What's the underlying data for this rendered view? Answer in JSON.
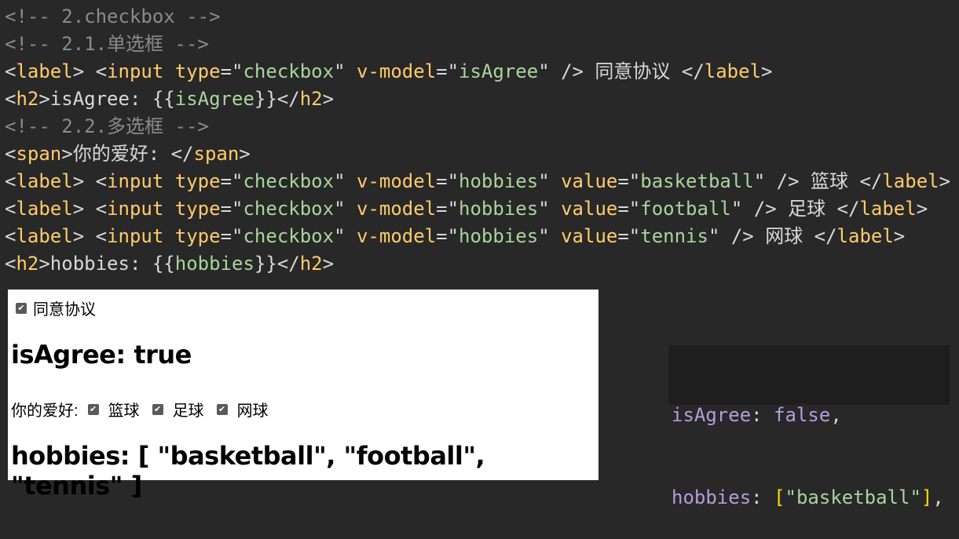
{
  "code_lines": [
    {
      "parts": [
        {
          "cls": "c-comment",
          "text": "<!-- 2.checkbox -->"
        }
      ]
    },
    {
      "parts": [
        {
          "cls": "c-comment",
          "text": "<!-- 2.1.单选框 -->"
        }
      ]
    },
    {
      "parts": [
        {
          "cls": "c-plain",
          "text": "<"
        },
        {
          "cls": "c-tag",
          "text": "label"
        },
        {
          "cls": "c-plain",
          "text": "> <"
        },
        {
          "cls": "c-tag",
          "text": "input"
        },
        {
          "cls": "c-plain",
          "text": " "
        },
        {
          "cls": "c-attr",
          "text": "type"
        },
        {
          "cls": "c-plain",
          "text": "=\""
        },
        {
          "cls": "c-str",
          "text": "checkbox"
        },
        {
          "cls": "c-plain",
          "text": "\" "
        },
        {
          "cls": "c-attr",
          "text": "v-model"
        },
        {
          "cls": "c-plain",
          "text": "=\""
        },
        {
          "cls": "c-str",
          "text": "isAgree"
        },
        {
          "cls": "c-plain",
          "text": "\" /> 同意协议 </"
        },
        {
          "cls": "c-tag",
          "text": "label"
        },
        {
          "cls": "c-plain",
          "text": ">"
        }
      ]
    },
    {
      "parts": [
        {
          "cls": "c-plain",
          "text": "<"
        },
        {
          "cls": "c-tag",
          "text": "h2"
        },
        {
          "cls": "c-plain",
          "text": ">isAgree: {{"
        },
        {
          "cls": "c-str",
          "text": "isAgree"
        },
        {
          "cls": "c-plain",
          "text": "}}</"
        },
        {
          "cls": "c-tag",
          "text": "h2"
        },
        {
          "cls": "c-plain",
          "text": ">"
        }
      ]
    },
    {
      "parts": [
        {
          "cls": "c-comment",
          "text": "<!-- 2.2.多选框 -->"
        }
      ]
    },
    {
      "parts": [
        {
          "cls": "c-plain",
          "text": "<"
        },
        {
          "cls": "c-tag",
          "text": "span"
        },
        {
          "cls": "c-plain",
          "text": ">你的爱好: </"
        },
        {
          "cls": "c-tag",
          "text": "span"
        },
        {
          "cls": "c-plain",
          "text": ">"
        }
      ]
    },
    {
      "parts": [
        {
          "cls": "c-plain",
          "text": "<"
        },
        {
          "cls": "c-tag",
          "text": "label"
        },
        {
          "cls": "c-plain",
          "text": "> <"
        },
        {
          "cls": "c-tag",
          "text": "input"
        },
        {
          "cls": "c-plain",
          "text": " "
        },
        {
          "cls": "c-attr",
          "text": "type"
        },
        {
          "cls": "c-plain",
          "text": "=\""
        },
        {
          "cls": "c-str",
          "text": "checkbox"
        },
        {
          "cls": "c-plain",
          "text": "\" "
        },
        {
          "cls": "c-attr",
          "text": "v-model"
        },
        {
          "cls": "c-plain",
          "text": "=\""
        },
        {
          "cls": "c-str",
          "text": "hobbies"
        },
        {
          "cls": "c-plain",
          "text": "\" "
        },
        {
          "cls": "c-attr",
          "text": "value"
        },
        {
          "cls": "c-plain",
          "text": "=\""
        },
        {
          "cls": "c-str",
          "text": "basketball"
        },
        {
          "cls": "c-plain",
          "text": "\" /> 篮球 </"
        },
        {
          "cls": "c-tag",
          "text": "label"
        },
        {
          "cls": "c-plain",
          "text": ">"
        }
      ]
    },
    {
      "parts": [
        {
          "cls": "c-plain",
          "text": "<"
        },
        {
          "cls": "c-tag",
          "text": "label"
        },
        {
          "cls": "c-plain",
          "text": "> <"
        },
        {
          "cls": "c-tag",
          "text": "input"
        },
        {
          "cls": "c-plain",
          "text": " "
        },
        {
          "cls": "c-attr",
          "text": "type"
        },
        {
          "cls": "c-plain",
          "text": "=\""
        },
        {
          "cls": "c-str",
          "text": "checkbox"
        },
        {
          "cls": "c-plain",
          "text": "\" "
        },
        {
          "cls": "c-attr",
          "text": "v-model"
        },
        {
          "cls": "c-plain",
          "text": "=\""
        },
        {
          "cls": "c-str",
          "text": "hobbies"
        },
        {
          "cls": "c-plain",
          "text": "\" "
        },
        {
          "cls": "c-attr",
          "text": "value"
        },
        {
          "cls": "c-plain",
          "text": "=\""
        },
        {
          "cls": "c-str",
          "text": "football"
        },
        {
          "cls": "c-plain",
          "text": "\" /> 足球 </"
        },
        {
          "cls": "c-tag",
          "text": "label"
        },
        {
          "cls": "c-plain",
          "text": ">"
        }
      ]
    },
    {
      "parts": [
        {
          "cls": "c-plain",
          "text": "<"
        },
        {
          "cls": "c-tag",
          "text": "label"
        },
        {
          "cls": "c-plain",
          "text": "> <"
        },
        {
          "cls": "c-tag",
          "text": "input"
        },
        {
          "cls": "c-plain",
          "text": " "
        },
        {
          "cls": "c-attr",
          "text": "type"
        },
        {
          "cls": "c-plain",
          "text": "=\""
        },
        {
          "cls": "c-str",
          "text": "checkbox"
        },
        {
          "cls": "c-plain",
          "text": "\" "
        },
        {
          "cls": "c-attr",
          "text": "v-model"
        },
        {
          "cls": "c-plain",
          "text": "=\""
        },
        {
          "cls": "c-str",
          "text": "hobbies"
        },
        {
          "cls": "c-plain",
          "text": "\" "
        },
        {
          "cls": "c-attr",
          "text": "value"
        },
        {
          "cls": "c-plain",
          "text": "=\""
        },
        {
          "cls": "c-str",
          "text": "tennis"
        },
        {
          "cls": "c-plain",
          "text": "\" /> 网球 </"
        },
        {
          "cls": "c-tag",
          "text": "label"
        },
        {
          "cls": "c-plain",
          "text": ">"
        }
      ]
    },
    {
      "parts": [
        {
          "cls": "c-plain",
          "text": "<"
        },
        {
          "cls": "c-tag",
          "text": "h2"
        },
        {
          "cls": "c-plain",
          "text": ">hobbies: {{"
        },
        {
          "cls": "c-str",
          "text": "hobbies"
        },
        {
          "cls": "c-plain",
          "text": "}}</"
        },
        {
          "cls": "c-tag",
          "text": "h2"
        },
        {
          "cls": "c-plain",
          "text": ">"
        }
      ]
    }
  ],
  "preview": {
    "agree_label": "同意协议",
    "agree_checked": true,
    "agree_heading": "isAgree: true",
    "hobby_prompt": "你的爱好:",
    "hobbies": [
      {
        "label": "篮球",
        "checked": true
      },
      {
        "label": "足球",
        "checked": true
      },
      {
        "label": "网球",
        "checked": true
      }
    ],
    "hobbies_heading": "hobbies: [ \"basketball\", \"football\", \"tennis\" ]",
    "checkmark_glyph": "✔"
  },
  "tooltip": {
    "line1_key": "isAgree",
    "line1_sep": ": ",
    "line1_val": "false",
    "line1_end": ",",
    "line2_key": "hobbies",
    "line2_sep": ": ",
    "line2_open": "[",
    "line2_str": "\"basketball\"",
    "line2_close": "]",
    "line2_end": ","
  },
  "colors": {
    "background": "#282828",
    "comment": "#8a8a8a",
    "tag": "#ffcb6b",
    "string": "#a9d59c",
    "tooltip_key": "#b39ddb",
    "tooltip_bracket": "#ffd700"
  }
}
